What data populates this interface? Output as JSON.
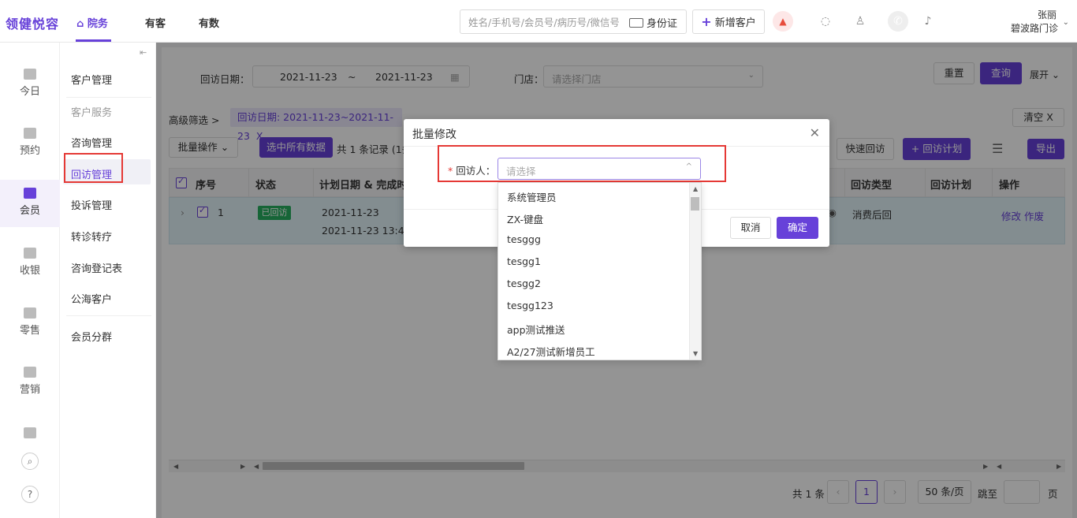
{
  "app": {
    "logo": "领健悦容"
  },
  "nav": {
    "items": [
      {
        "label": "院务",
        "active": true
      },
      {
        "label": "有客",
        "active": false
      },
      {
        "label": "有数",
        "active": false
      }
    ]
  },
  "header": {
    "search_placeholder": "姓名/手机号/会员号/病历号/微信号",
    "idcard_label": "身份证",
    "new_customer_label": "新增客户",
    "user_name": "张丽",
    "user_store": "碧波路门诊"
  },
  "left_sidebar": {
    "items": [
      {
        "label": "今日"
      },
      {
        "label": "预约"
      },
      {
        "label": "会员",
        "active": true
      },
      {
        "label": "收银"
      },
      {
        "label": "零售"
      },
      {
        "label": "营销"
      }
    ]
  },
  "sub_sidebar": {
    "items": [
      {
        "label": "客户管理"
      },
      {
        "label": "客户服务",
        "muted": true
      },
      {
        "label": "咨询管理"
      },
      {
        "label": "回访管理",
        "active": true
      },
      {
        "label": "投诉管理"
      },
      {
        "label": "转诊转疗"
      },
      {
        "label": "咨询登记表"
      },
      {
        "label": "公海客户"
      },
      {
        "label": "会员分群"
      }
    ]
  },
  "filters": {
    "date_label": "回访日期：",
    "date_start": "2021-11-23",
    "date_sep": "~",
    "date_end": "2021-11-23",
    "store_label": "门店：",
    "store_placeholder": "请选择门店",
    "reset": "重置",
    "query": "查询",
    "expand": "展开"
  },
  "advanced": {
    "label": "高级筛选 >",
    "tag": "回访日期: 2021-11-23~2021-11-23",
    "tag_close": "X",
    "clear": "清空",
    "clear_x": "X"
  },
  "toolbar": {
    "batch": "批量操作",
    "select_all": "选中所有数据",
    "record_count": "共 1 条记录  (1条",
    "quick": "快速回访",
    "plan": "+ 回访计划",
    "export": "导出"
  },
  "table": {
    "headers": [
      "序号",
      "状态",
      "计划日期 & 完成时间",
      "回访类型",
      "回访计划",
      "操作"
    ],
    "rows": [
      {
        "index": "1",
        "status": "已回访",
        "plan_date": "2021-11-23",
        "done_time": "2021-11-23 13:45",
        "type": "消费后回",
        "plan": "",
        "actions": "修改 作废"
      }
    ]
  },
  "pagination": {
    "total": "共 1 条",
    "current": "1",
    "page_size": "50 条/页",
    "goto": "跳至",
    "page_unit": "页"
  },
  "modal": {
    "title": "批量修改",
    "field_label": "回访人：",
    "field_placeholder": "请选择",
    "cancel": "取消",
    "confirm": "确定",
    "options": [
      "系统管理员",
      "ZX-键盘",
      "tesggg",
      "tesgg1",
      "tesgg2",
      "tesgg123",
      "app测试推送",
      "A2/27测试新增员工"
    ]
  },
  "colors": {
    "accent": "#6741d9",
    "highlight": "#e53935",
    "status_done": "#27ae60"
  }
}
